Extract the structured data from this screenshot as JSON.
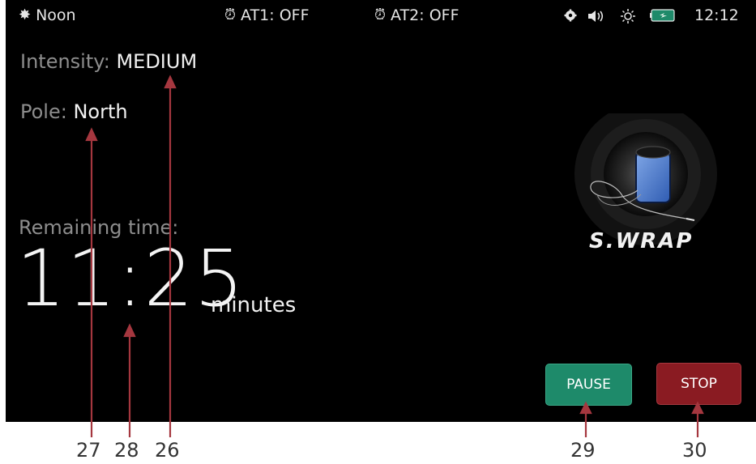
{
  "status_bar": {
    "mode_icon": "sun-small-icon",
    "mode_label": "Noon",
    "alarm1_icon": "alarm-clock-icon",
    "alarm1_label": "AT1: OFF",
    "alarm2_icon": "alarm-clock-icon",
    "alarm2_label": "AT2: OFF",
    "settings_icon": "gear-icon",
    "volume_icon": "speaker-icon",
    "brightness_icon": "brightness-icon",
    "battery_icon": "battery-charging-icon",
    "clock": "12:12"
  },
  "session": {
    "intensity_label": "Intensity:",
    "intensity_value": "MEDIUM",
    "pole_label": "Pole:",
    "pole_value": "North",
    "remaining_label": "Remaining time:",
    "remaining_value": "11:25",
    "remaining_unit": "minutes"
  },
  "applicator": {
    "name": "S.WRAP",
    "image_icon": "wrap-applicator-icon"
  },
  "controls": {
    "pause_label": "PAUSE",
    "stop_label": "STOP",
    "pause_color": "#1e8a6a",
    "stop_color": "#8a1b22"
  },
  "callouts": [
    {
      "number": "27"
    },
    {
      "number": "28"
    },
    {
      "number": "26"
    },
    {
      "number": "29"
    },
    {
      "number": "30"
    }
  ],
  "colors": {
    "background": "#000000",
    "label_gray": "#8d8d8d",
    "callout_arrow": "#a5373f"
  }
}
